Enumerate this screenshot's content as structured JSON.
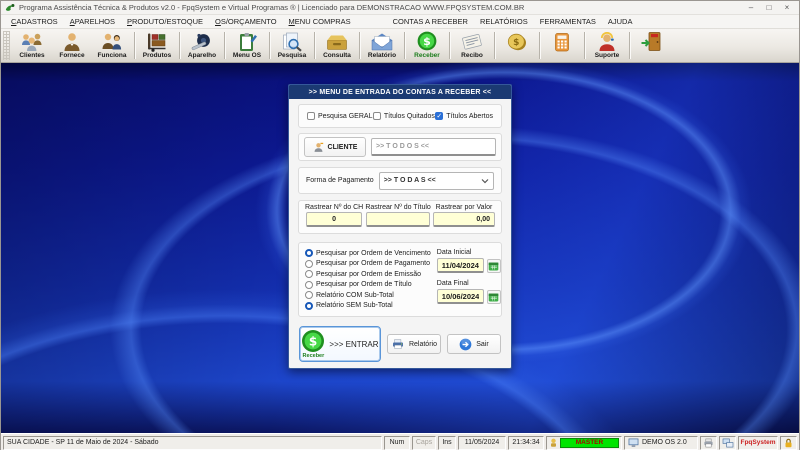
{
  "window": {
    "title": "Programa Assistência Técnica & Produtos v2.0 - FpqSystem e Virtual Programas ® | Licenciado para  DEMONSTRACAO WWW.FPQSYSTEM.COM.BR",
    "minimize": "–",
    "maximize": "□",
    "close": "×"
  },
  "menu": {
    "items": [
      {
        "label": "CADASTROS"
      },
      {
        "label": "APARELHOS"
      },
      {
        "label": "PRODUTO/ESTOQUE"
      },
      {
        "label": "OS/ORÇAMENTO"
      },
      {
        "label": "MENU COMPRAS"
      },
      {
        "label": "CONTAS A RECEBER"
      },
      {
        "label": "RELATÓRIOS"
      },
      {
        "label": "FERRAMENTAS"
      },
      {
        "label": "AJUDA"
      }
    ]
  },
  "toolbar": {
    "buttons": [
      {
        "label": "Clientes",
        "icon": "clients-icon"
      },
      {
        "label": "Fornece",
        "icon": "supplier-icon"
      },
      {
        "label": "Funciona",
        "icon": "employees-icon"
      },
      {
        "label": "Produtos",
        "icon": "products-icon"
      },
      {
        "label": "Aparelho",
        "icon": "device-icon"
      },
      {
        "label": "Menu OS",
        "icon": "service-order-icon"
      },
      {
        "label": "Pesquisa",
        "icon": "search-icon"
      },
      {
        "label": "Consulta",
        "icon": "lookup-icon"
      },
      {
        "label": "Relatório",
        "icon": "report-icon"
      },
      {
        "label": "Receber",
        "icon": "receive-icon"
      },
      {
        "label": "Recibo",
        "icon": "receipt-icon"
      },
      {
        "label": "",
        "icon": "coin-icon"
      },
      {
        "label": "",
        "icon": "calculator-icon"
      },
      {
        "label": "Suporte",
        "icon": "support-icon"
      },
      {
        "label": "",
        "icon": "exit-icon"
      }
    ]
  },
  "dialog": {
    "title": ">>  MENU DE ENTRADA DO CONTAS A RECEBER  <<",
    "checkboxes": [
      {
        "label": "Pesquisa GERAL",
        "checked": false
      },
      {
        "label": "Títulos Quitados",
        "checked": false
      },
      {
        "label": "Títulos Abertos",
        "checked": true
      }
    ],
    "cliente": {
      "button": "CLIENTE",
      "value": ">> T O D O S <<"
    },
    "forma_pagamento": {
      "label": "Forma de Pagamento",
      "value": ">> T O D A S <<"
    },
    "rastrear": {
      "ch": {
        "label": "Rastrear Nº do CH",
        "value": "0"
      },
      "titulo": {
        "label": "Rastrear Nº do Título",
        "value": ""
      },
      "valor": {
        "label": "Rastrear por Valor",
        "value": "0,00"
      }
    },
    "radios": [
      {
        "label": "Pesquisar por Ordem de Vencimento",
        "checked": true
      },
      {
        "label": "Pesquisar por Ordem de Pagamento",
        "checked": false
      },
      {
        "label": "Pesquisar por Ordem de Emissão",
        "checked": false
      },
      {
        "label": "Pesquisar por Ordem de Título",
        "checked": false
      },
      {
        "label": "Relatório COM Sub-Total",
        "checked": false
      },
      {
        "label": "Relatório SEM Sub-Total",
        "checked": true
      }
    ],
    "dates": {
      "inicial_label": "Data Inicial",
      "inicial_value": "11/04/2024",
      "final_label": "Data Final",
      "final_value": "10/06/2024"
    },
    "buttons": {
      "entrar_label": ">>> ENTRAR",
      "entrar_icon_caption": "Receber",
      "relatorio_label": "Relatório",
      "sair_label": "Sair"
    }
  },
  "statusbar": {
    "location": "SUA CIDADE - SP 11 de Maio de 2024 - Sábado",
    "num": "Num",
    "caps": "Caps",
    "ins": "Ins",
    "date": "11/05/2024",
    "time": "21:34:34",
    "user": "MASTER",
    "system": "DEMO OS 2.0",
    "brand": "FpqSystem"
  },
  "colors": {
    "dialog_title_bg": "#1b3a73",
    "accent_blue": "#2a6fd6",
    "field_yellow": "#ffffd6",
    "user_badge_bg": "#00e400",
    "user_badge_text": "#aa0000",
    "brand_text": "#cc2222",
    "receive_green": "#46d846"
  }
}
